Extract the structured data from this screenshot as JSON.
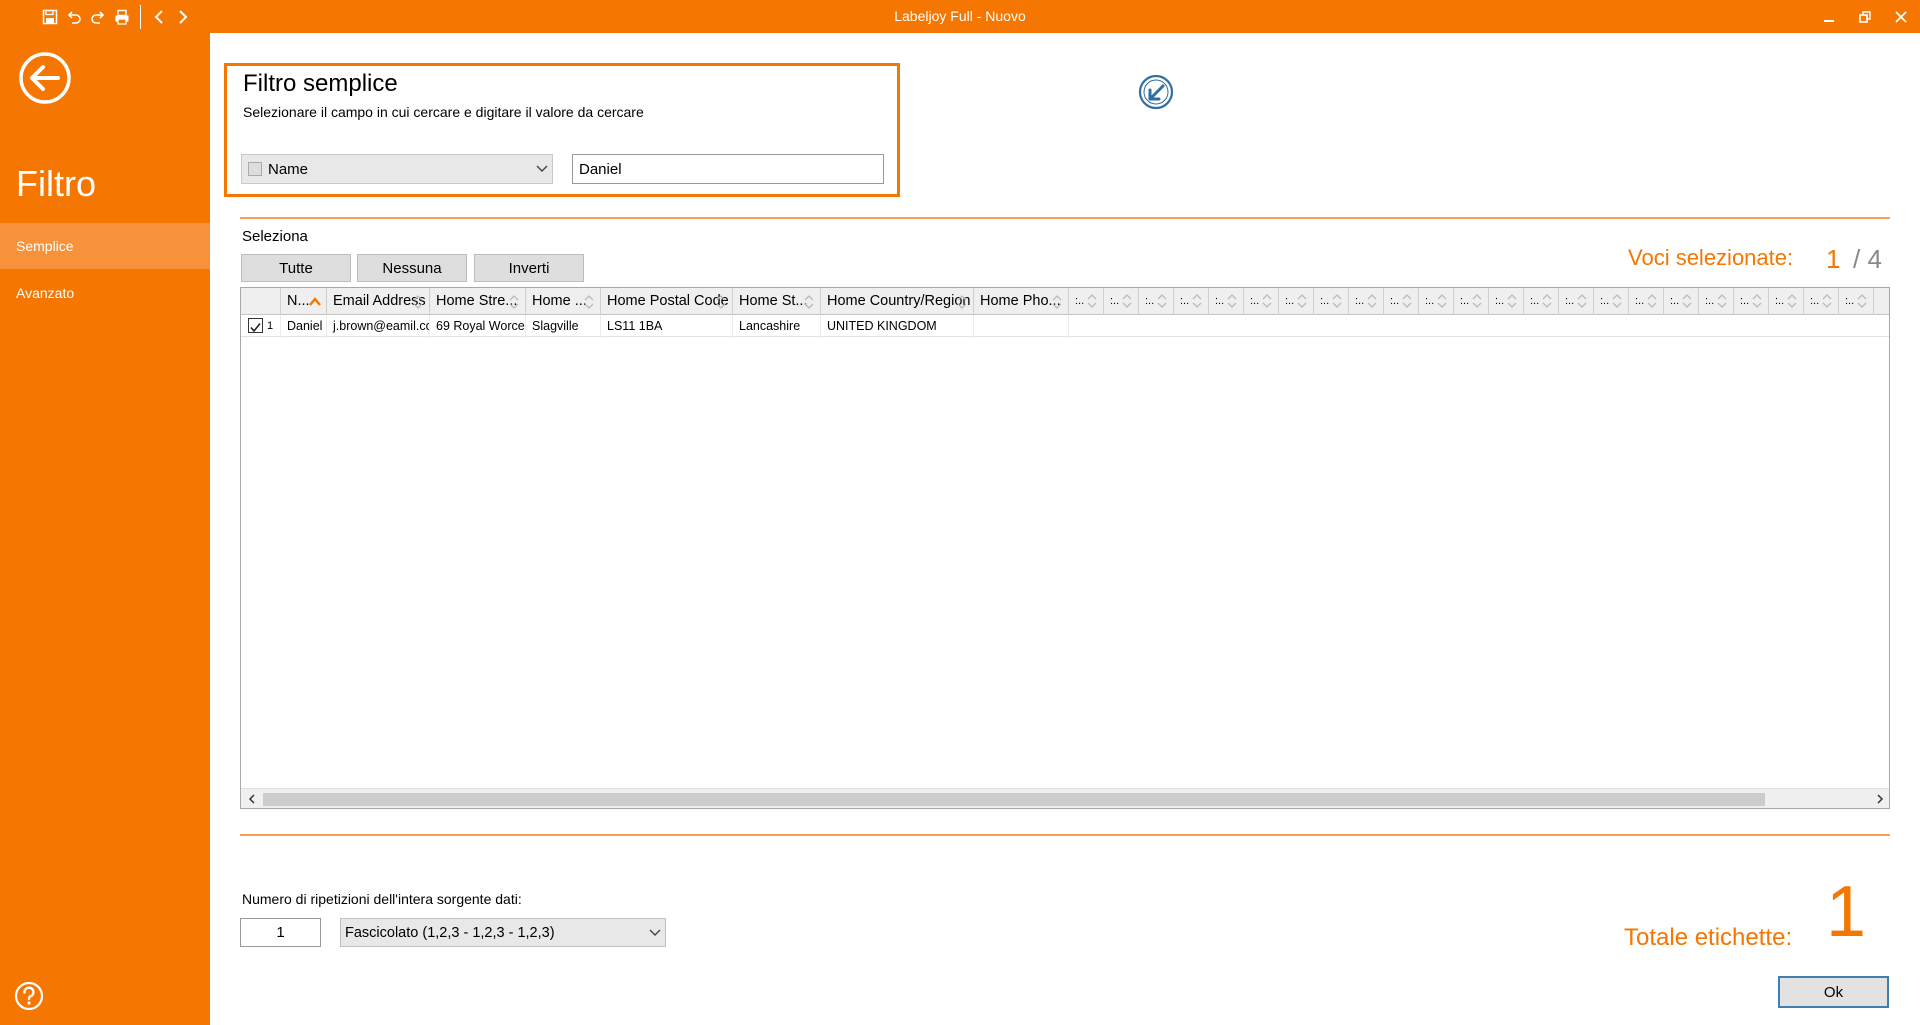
{
  "window": {
    "title": "Labeljoy Full - Nuovo",
    "accent": "#f57600",
    "quick_access_icons": [
      "save-icon",
      "undo-icon",
      "redo-icon",
      "print-icon",
      "back-arrow-icon",
      "forward-arrow-icon"
    ],
    "window_controls": [
      "minimize-icon",
      "restore-icon",
      "close-icon"
    ]
  },
  "sidebar": {
    "title": "Filtro",
    "items": [
      {
        "label": "Semplice",
        "active": true
      },
      {
        "label": "Avanzato",
        "active": false
      }
    ]
  },
  "simple_filter": {
    "title": "Filtro semplice",
    "subtitle": "Selezionare il campo in cui cercare e digitare il valore da cercare",
    "field": "Name",
    "value": "Daniel"
  },
  "selection": {
    "label": "Seleziona",
    "all_label": "Tutte",
    "none_label": "Nessuna",
    "invert_label": "Inverti",
    "count_label": "Voci selezionate:",
    "selected": "1",
    "total": "/ 4"
  },
  "grid": {
    "columns": [
      "N...",
      "Email Address",
      "Home Stre...",
      "Home ...",
      "Home Postal Code",
      "Home St...",
      "Home Country/Region",
      "Home Pho..."
    ],
    "extra_column_label": ":..",
    "rows": [
      {
        "checked": true,
        "index": "1",
        "cells": [
          "Daniel ...",
          "j.brown@eamil.com",
          "69 Royal Worce...",
          "Slagville",
          "LS11 1BA",
          "Lancashire",
          "UNITED KINGDOM",
          ""
        ]
      }
    ]
  },
  "repetitions": {
    "label": "Numero di ripetizioni dell'intera sorgente dati:",
    "value": "1",
    "collate_option": "Fascicolato (1,2,3 - 1,2,3 - 1,2,3)"
  },
  "totals": {
    "label": "Totale etichette:",
    "value": "1"
  },
  "ok_label": "Ok"
}
